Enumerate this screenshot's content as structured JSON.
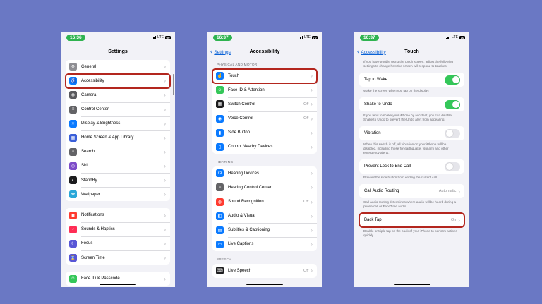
{
  "screens": [
    {
      "time": "16:36",
      "network": "LTE",
      "battery": "69",
      "title": "Settings",
      "groups": [
        [
          {
            "label": "General",
            "icon": "gear-icon",
            "color": "#8e8e93",
            "glyph": "⚙"
          },
          {
            "label": "Accessibility",
            "icon": "accessibility-icon",
            "color": "#0a7aff",
            "glyph": "♿",
            "highlight": true
          },
          {
            "label": "Camera",
            "icon": "camera-icon",
            "color": "#5a5a5e",
            "glyph": "◉"
          },
          {
            "label": "Control Center",
            "icon": "control-center-icon",
            "color": "#636366",
            "glyph": "≡"
          },
          {
            "label": "Display & Brightness",
            "icon": "brightness-icon",
            "color": "#0a7aff",
            "glyph": "☀"
          },
          {
            "label": "Home Screen & App Library",
            "icon": "home-screen-icon",
            "color": "#3a5fd8",
            "glyph": "▦"
          },
          {
            "label": "Search",
            "icon": "search-icon",
            "color": "#636366",
            "glyph": "⌕"
          },
          {
            "label": "Siri",
            "icon": "siri-icon",
            "color": "#7d4cc9",
            "glyph": "◎"
          },
          {
            "label": "StandBy",
            "icon": "standby-icon",
            "color": "#1c1c1e",
            "glyph": "◐"
          },
          {
            "label": "Wallpaper",
            "icon": "wallpaper-icon",
            "color": "#2aa7d8",
            "glyph": "✿"
          }
        ],
        [
          {
            "label": "Notifications",
            "icon": "notifications-icon",
            "color": "#ff3b30",
            "glyph": "▣"
          },
          {
            "label": "Sounds & Haptics",
            "icon": "sound-icon",
            "color": "#ff2d55",
            "glyph": "♪"
          },
          {
            "label": "Focus",
            "icon": "focus-icon",
            "color": "#5856d6",
            "glyph": "☾"
          },
          {
            "label": "Screen Time",
            "icon": "screen-time-icon",
            "color": "#5856d6",
            "glyph": "⌛"
          }
        ],
        [
          {
            "label": "Face ID & Passcode",
            "icon": "face-id-icon",
            "color": "#34c759",
            "glyph": "☺"
          }
        ]
      ]
    },
    {
      "time": "16:37",
      "network": "LTE",
      "battery": "70",
      "back": "Settings",
      "title": "Accessibility",
      "sections": [
        {
          "header": "PHYSICAL AND MOTOR",
          "rows": [
            {
              "label": "Touch",
              "icon": "touch-icon",
              "color": "#0a7aff",
              "glyph": "☝",
              "highlight": true
            },
            {
              "label": "Face ID & Attention",
              "icon": "face-id-icon",
              "color": "#34c759",
              "glyph": "☺"
            },
            {
              "label": "Switch Control",
              "icon": "switch-control-icon",
              "color": "#1c1c1e",
              "glyph": "▦",
              "value": "Off"
            },
            {
              "label": "Voice Control",
              "icon": "voice-control-icon",
              "color": "#0a7aff",
              "glyph": "◉",
              "value": "Off"
            },
            {
              "label": "Side Button",
              "icon": "side-button-icon",
              "color": "#0a7aff",
              "glyph": "▮"
            },
            {
              "label": "Control Nearby Devices",
              "icon": "nearby-devices-icon",
              "color": "#0a7aff",
              "glyph": "▯"
            }
          ]
        },
        {
          "header": "HEARING",
          "rows": [
            {
              "label": "Hearing Devices",
              "icon": "hearing-devices-icon",
              "color": "#0a7aff",
              "glyph": "☊"
            },
            {
              "label": "Hearing Control Center",
              "icon": "hearing-control-icon",
              "color": "#636366",
              "glyph": "≡"
            },
            {
              "label": "Sound Recognition",
              "icon": "sound-recognition-icon",
              "color": "#ff3b30",
              "glyph": "◍",
              "value": "Off"
            },
            {
              "label": "Audio & Visual",
              "icon": "audio-visual-icon",
              "color": "#0a7aff",
              "glyph": "◧"
            },
            {
              "label": "Subtitles & Captioning",
              "icon": "subtitles-icon",
              "color": "#0a7aff",
              "glyph": "▤"
            },
            {
              "label": "Live Captions",
              "icon": "live-captions-icon",
              "color": "#0a7aff",
              "glyph": "▭"
            }
          ]
        },
        {
          "header": "SPEECH",
          "rows": [
            {
              "label": "Live Speech",
              "icon": "live-speech-icon",
              "color": "#1c1c1e",
              "glyph": "⌨",
              "value": "Off"
            }
          ]
        }
      ]
    },
    {
      "time": "16:37",
      "network": "LTE",
      "battery": "70",
      "back": "Accessibility",
      "title": "Touch",
      "intro": "If you have trouble using the touch screen, adjust the following settings to change how the screen will respond to touches.",
      "items": [
        {
          "label": "Tap to Wake",
          "toggle": "on",
          "note": "Wake the screen when you tap on the display."
        },
        {
          "label": "Shake to Undo",
          "toggle": "on",
          "note": "If you tend to shake your iPhone by accident, you can disable Shake to Undo to prevent the Undo alert from appearing."
        },
        {
          "label": "Vibration",
          "toggle": "off",
          "note": "When this switch is off, all vibration on your iPhone will be disabled, including those for earthquake, tsunami and other emergency alerts."
        },
        {
          "label": "Prevent Lock to End Call",
          "toggle": "off",
          "note": "Prevent the side button from ending the current call."
        },
        {
          "label": "Call Audio Routing",
          "value": "Automatic",
          "note": "Call audio routing determines where audio will be heard during a phone call or FaceTime audio."
        },
        {
          "label": "Back Tap",
          "value": "On",
          "highlight": true,
          "note": "Double or triple tap on the back of your iPhone to perform actions quickly."
        }
      ]
    }
  ],
  "colors": {
    "background": "#6a78c4",
    "highlight": "#b3261e",
    "toggle_on": "#34c759",
    "link": "#0a62d6"
  }
}
